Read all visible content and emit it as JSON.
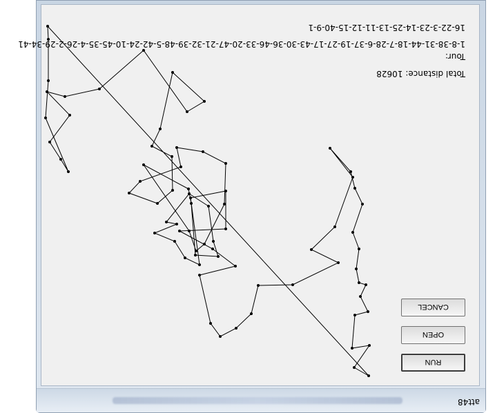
{
  "window": {
    "title": "att48"
  },
  "buttons": {
    "run": "RUN",
    "open": "OPEN",
    "cancel": "CANCEL"
  },
  "result": {
    "distance_label": "Total distance:",
    "distance_value": "10628",
    "tour_label": "Tour:",
    "tour_line_1": "1-8-38-31-44-18-7-28-6-37-19-27-17-43-30-36-46-33-20-47-21-32-39-48-5-42-24-10-45-35-4-26-2-29-34-41",
    "tour_line_2": "16-22-3-23-14-25-13-11-12-15-40-9-1"
  },
  "colors": {
    "client_bg": "#f0f0f0",
    "path": "#000000"
  }
}
